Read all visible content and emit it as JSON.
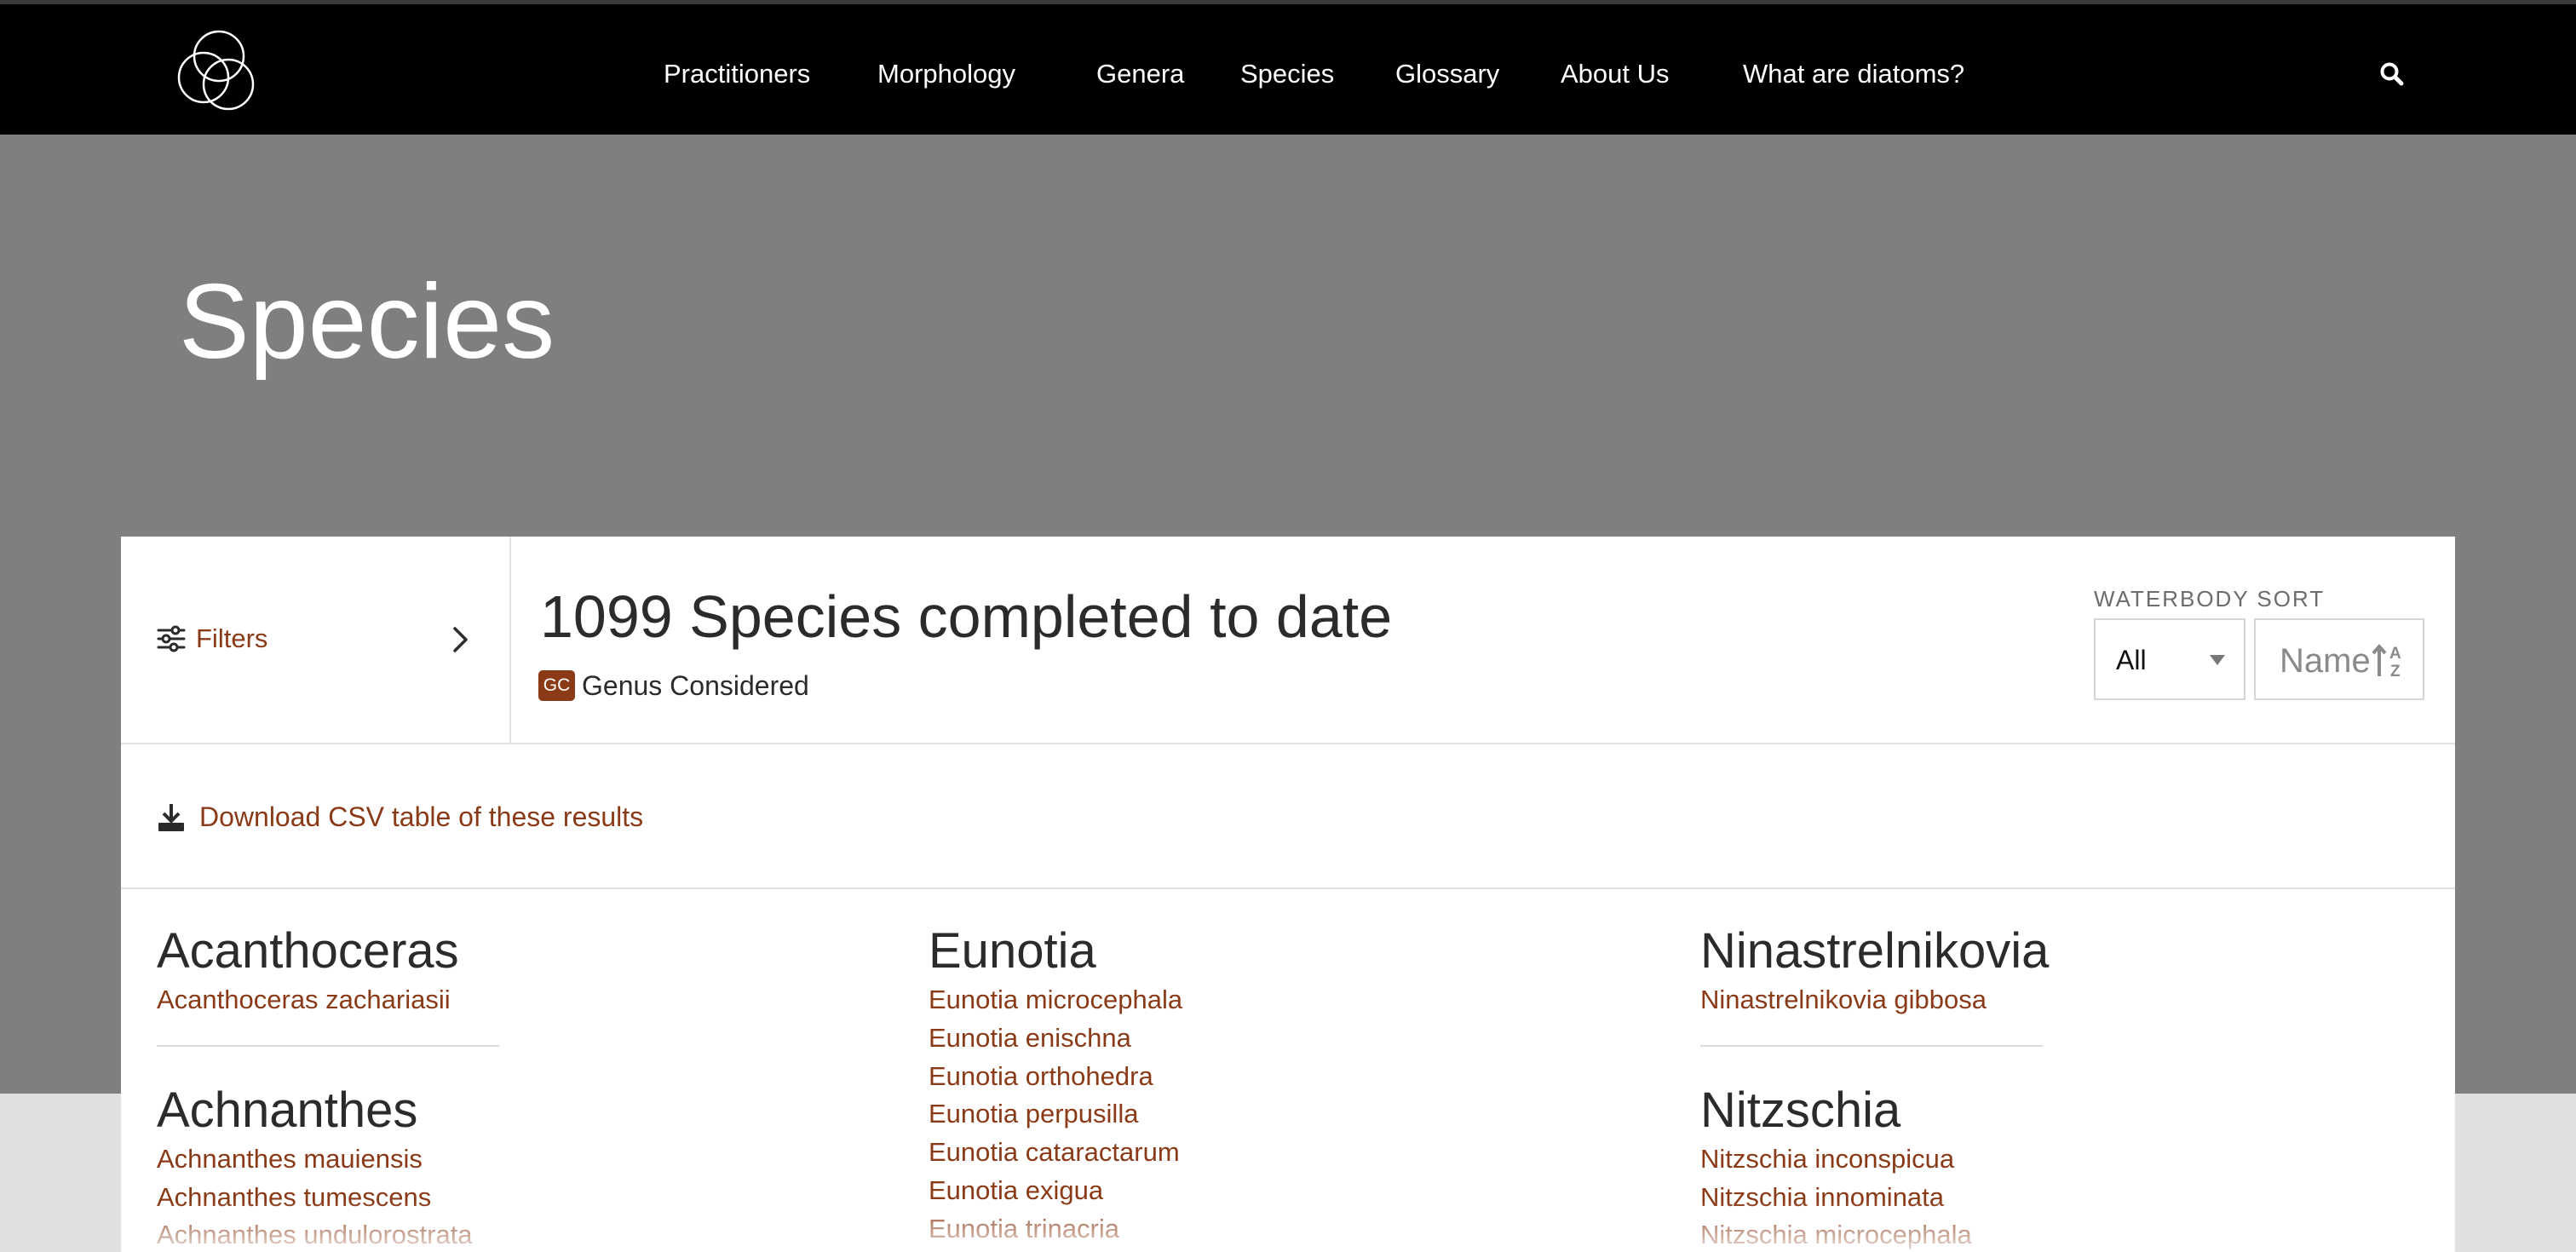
{
  "header": {
    "nav": [
      {
        "label": "Practitioners"
      },
      {
        "label": "Morphology"
      },
      {
        "label": "Genera"
      },
      {
        "label": "Species"
      },
      {
        "label": "Glossary"
      },
      {
        "label": "About Us"
      },
      {
        "label": "What are diatoms?"
      }
    ],
    "icons": {
      "logo": "overlapping-circles-logo",
      "search": "search-icon"
    }
  },
  "hero": {
    "title": "Species"
  },
  "toolbar": {
    "filters_label": "Filters",
    "count_title": "1099 Species completed to date",
    "badge": "GC",
    "badge_label": "Genus Considered",
    "sort_label": "WATERBODY SORT",
    "waterbody_value": "All",
    "name_sort_label": "Name"
  },
  "download": {
    "label": "Download CSV table of these results"
  },
  "columns": [
    {
      "groups": [
        {
          "genus": "Acanthoceras",
          "species": [
            "Acanthoceras zachariasii"
          ]
        },
        {
          "genus": "Achnanthes",
          "species": [
            "Achnanthes mauiensis",
            "Achnanthes tumescens",
            "Achnanthes undulorostrata"
          ]
        }
      ]
    },
    {
      "groups": [
        {
          "genus": "Eunotia",
          "species": [
            "Eunotia microcephala",
            "Eunotia enischna",
            "Eunotia orthohedra",
            "Eunotia perpusilla",
            "Eunotia cataractarum",
            "Eunotia exigua",
            "Eunotia trinacria"
          ]
        }
      ]
    },
    {
      "groups": [
        {
          "genus": "Ninastrelnikovia",
          "species": [
            "Ninastrelnikovia gibbosa"
          ]
        },
        {
          "genus": "Nitzschia",
          "species": [
            "Nitzschia inconspicua",
            "Nitzschia innominata",
            "Nitzschia microcephala"
          ]
        }
      ]
    }
  ],
  "colors": {
    "link": "#8a3a17",
    "hero": "#7f7f7f",
    "topbar": "#000000",
    "text": "#2b2b2b"
  }
}
